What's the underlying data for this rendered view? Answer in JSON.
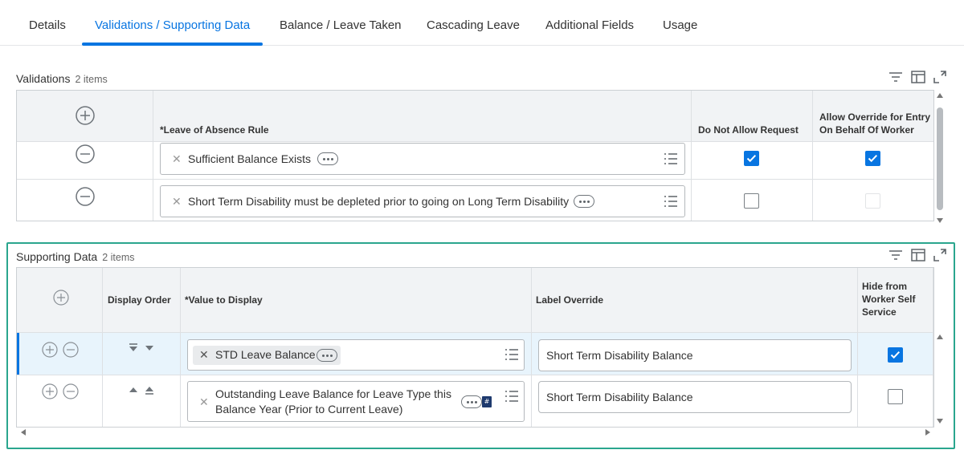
{
  "tabs": [
    {
      "label": "Details"
    },
    {
      "label": "Validations / Supporting Data"
    },
    {
      "label": "Balance / Leave Taken"
    },
    {
      "label": "Cascading Leave"
    },
    {
      "label": "Additional Fields"
    },
    {
      "label": "Usage"
    }
  ],
  "validations": {
    "title": "Validations",
    "count": "2 items",
    "headers": {
      "rule": "*Leave of Absence Rule",
      "do_not_allow": "Do Not Allow Request",
      "allow_override": "Allow Override for Entry On Behalf Of Worker"
    },
    "rows": [
      {
        "rule": "Sufficient Balance Exists",
        "do_not_allow": true,
        "allow_override": true
      },
      {
        "rule": "Short Term Disability must be depleted prior to going on Long Term Disability",
        "do_not_allow": false,
        "allow_override": false
      }
    ]
  },
  "supporting": {
    "title": "Supporting Data",
    "count": "2 items",
    "headers": {
      "display_order": "Display Order",
      "value": "*Value to Display",
      "label_override": "Label Override",
      "hide": "Hide from Worker Self Service"
    },
    "rows": [
      {
        "value": "STD Leave Balance",
        "label_override": "Short Term Disability Balance",
        "hide": true
      },
      {
        "value_line1": "Outstanding Leave Balance for Leave Type this",
        "value_line2": "Balance Year (Prior to Current Leave)",
        "label_override": "Short Term Disability Balance",
        "hide": false
      }
    ]
  },
  "colors": {
    "accent": "#0875e1",
    "highlight_border": "#2aa68e",
    "row_selected": "#e8f4fc"
  },
  "icons": [
    "filter-icon",
    "columns-icon",
    "expand-icon",
    "plus-circle-icon",
    "minus-circle-icon",
    "ellipsis-icon",
    "list-icon",
    "sort-down-icon",
    "sort-up-icon",
    "number-badge-icon",
    "close-icon"
  ]
}
